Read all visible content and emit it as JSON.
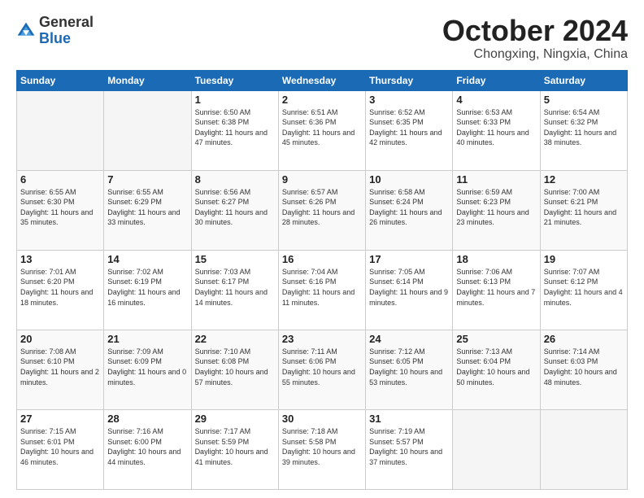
{
  "header": {
    "logo_general": "General",
    "logo_blue": "Blue",
    "month_title": "October 2024",
    "location": "Chongxing, Ningxia, China"
  },
  "weekdays": [
    "Sunday",
    "Monday",
    "Tuesday",
    "Wednesday",
    "Thursday",
    "Friday",
    "Saturday"
  ],
  "weeks": [
    [
      {
        "day": "",
        "empty": true
      },
      {
        "day": "",
        "empty": true
      },
      {
        "day": "1",
        "info": "Sunrise: 6:50 AM\nSunset: 6:38 PM\nDaylight: 11 hours and 47 minutes."
      },
      {
        "day": "2",
        "info": "Sunrise: 6:51 AM\nSunset: 6:36 PM\nDaylight: 11 hours and 45 minutes."
      },
      {
        "day": "3",
        "info": "Sunrise: 6:52 AM\nSunset: 6:35 PM\nDaylight: 11 hours and 42 minutes."
      },
      {
        "day": "4",
        "info": "Sunrise: 6:53 AM\nSunset: 6:33 PM\nDaylight: 11 hours and 40 minutes."
      },
      {
        "day": "5",
        "info": "Sunrise: 6:54 AM\nSunset: 6:32 PM\nDaylight: 11 hours and 38 minutes."
      }
    ],
    [
      {
        "day": "6",
        "info": "Sunrise: 6:55 AM\nSunset: 6:30 PM\nDaylight: 11 hours and 35 minutes."
      },
      {
        "day": "7",
        "info": "Sunrise: 6:55 AM\nSunset: 6:29 PM\nDaylight: 11 hours and 33 minutes."
      },
      {
        "day": "8",
        "info": "Sunrise: 6:56 AM\nSunset: 6:27 PM\nDaylight: 11 hours and 30 minutes."
      },
      {
        "day": "9",
        "info": "Sunrise: 6:57 AM\nSunset: 6:26 PM\nDaylight: 11 hours and 28 minutes."
      },
      {
        "day": "10",
        "info": "Sunrise: 6:58 AM\nSunset: 6:24 PM\nDaylight: 11 hours and 26 minutes."
      },
      {
        "day": "11",
        "info": "Sunrise: 6:59 AM\nSunset: 6:23 PM\nDaylight: 11 hours and 23 minutes."
      },
      {
        "day": "12",
        "info": "Sunrise: 7:00 AM\nSunset: 6:21 PM\nDaylight: 11 hours and 21 minutes."
      }
    ],
    [
      {
        "day": "13",
        "info": "Sunrise: 7:01 AM\nSunset: 6:20 PM\nDaylight: 11 hours and 18 minutes."
      },
      {
        "day": "14",
        "info": "Sunrise: 7:02 AM\nSunset: 6:19 PM\nDaylight: 11 hours and 16 minutes."
      },
      {
        "day": "15",
        "info": "Sunrise: 7:03 AM\nSunset: 6:17 PM\nDaylight: 11 hours and 14 minutes."
      },
      {
        "day": "16",
        "info": "Sunrise: 7:04 AM\nSunset: 6:16 PM\nDaylight: 11 hours and 11 minutes."
      },
      {
        "day": "17",
        "info": "Sunrise: 7:05 AM\nSunset: 6:14 PM\nDaylight: 11 hours and 9 minutes."
      },
      {
        "day": "18",
        "info": "Sunrise: 7:06 AM\nSunset: 6:13 PM\nDaylight: 11 hours and 7 minutes."
      },
      {
        "day": "19",
        "info": "Sunrise: 7:07 AM\nSunset: 6:12 PM\nDaylight: 11 hours and 4 minutes."
      }
    ],
    [
      {
        "day": "20",
        "info": "Sunrise: 7:08 AM\nSunset: 6:10 PM\nDaylight: 11 hours and 2 minutes."
      },
      {
        "day": "21",
        "info": "Sunrise: 7:09 AM\nSunset: 6:09 PM\nDaylight: 11 hours and 0 minutes."
      },
      {
        "day": "22",
        "info": "Sunrise: 7:10 AM\nSunset: 6:08 PM\nDaylight: 10 hours and 57 minutes."
      },
      {
        "day": "23",
        "info": "Sunrise: 7:11 AM\nSunset: 6:06 PM\nDaylight: 10 hours and 55 minutes."
      },
      {
        "day": "24",
        "info": "Sunrise: 7:12 AM\nSunset: 6:05 PM\nDaylight: 10 hours and 53 minutes."
      },
      {
        "day": "25",
        "info": "Sunrise: 7:13 AM\nSunset: 6:04 PM\nDaylight: 10 hours and 50 minutes."
      },
      {
        "day": "26",
        "info": "Sunrise: 7:14 AM\nSunset: 6:03 PM\nDaylight: 10 hours and 48 minutes."
      }
    ],
    [
      {
        "day": "27",
        "info": "Sunrise: 7:15 AM\nSunset: 6:01 PM\nDaylight: 10 hours and 46 minutes."
      },
      {
        "day": "28",
        "info": "Sunrise: 7:16 AM\nSunset: 6:00 PM\nDaylight: 10 hours and 44 minutes."
      },
      {
        "day": "29",
        "info": "Sunrise: 7:17 AM\nSunset: 5:59 PM\nDaylight: 10 hours and 41 minutes."
      },
      {
        "day": "30",
        "info": "Sunrise: 7:18 AM\nSunset: 5:58 PM\nDaylight: 10 hours and 39 minutes."
      },
      {
        "day": "31",
        "info": "Sunrise: 7:19 AM\nSunset: 5:57 PM\nDaylight: 10 hours and 37 minutes."
      },
      {
        "day": "",
        "empty": true
      },
      {
        "day": "",
        "empty": true
      }
    ]
  ]
}
